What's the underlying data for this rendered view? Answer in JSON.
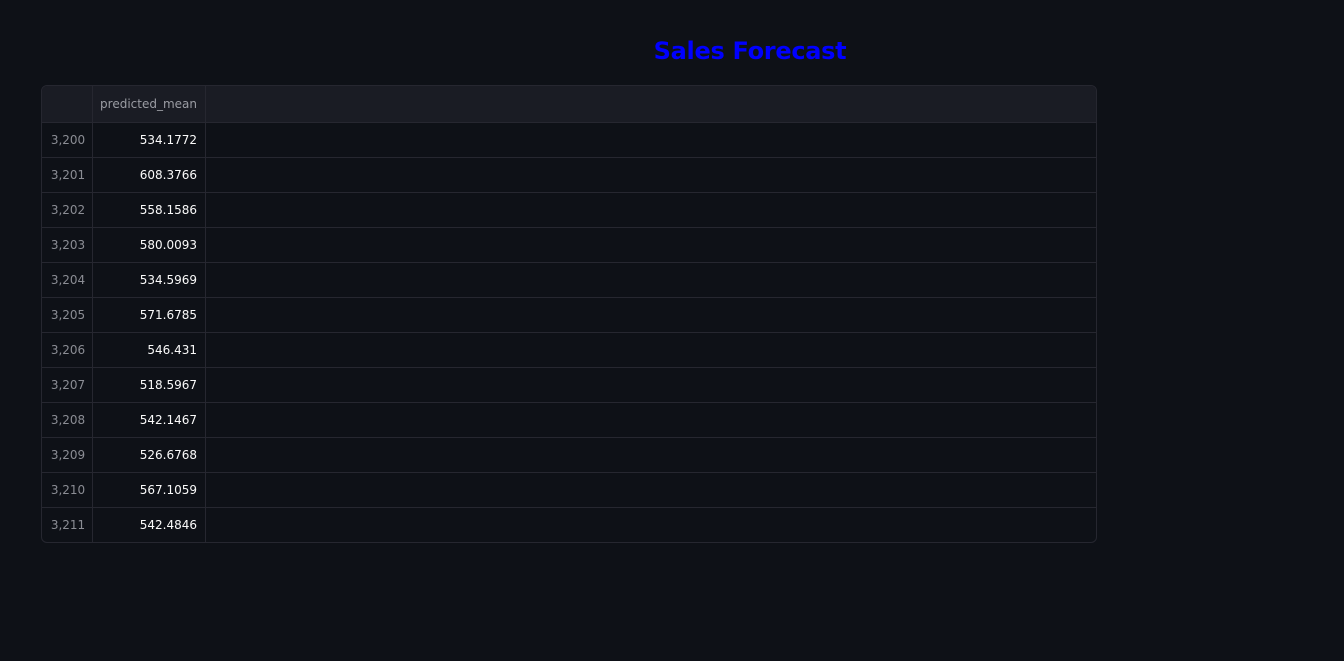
{
  "page": {
    "title": "Sales Forecast",
    "title_color": "#0000ff",
    "background": "#0e1117"
  },
  "table": {
    "index_header": "",
    "columns": [
      "predicted_mean"
    ],
    "rows": [
      {
        "index": "3,200",
        "predicted_mean": "534.1772"
      },
      {
        "index": "3,201",
        "predicted_mean": "608.3766"
      },
      {
        "index": "3,202",
        "predicted_mean": "558.1586"
      },
      {
        "index": "3,203",
        "predicted_mean": "580.0093"
      },
      {
        "index": "3,204",
        "predicted_mean": "534.5969"
      },
      {
        "index": "3,205",
        "predicted_mean": "571.6785"
      },
      {
        "index": "3,206",
        "predicted_mean": "546.431"
      },
      {
        "index": "3,207",
        "predicted_mean": "518.5967"
      },
      {
        "index": "3,208",
        "predicted_mean": "542.1467"
      },
      {
        "index": "3,209",
        "predicted_mean": "526.6768"
      },
      {
        "index": "3,210",
        "predicted_mean": "567.1059"
      },
      {
        "index": "3,211",
        "predicted_mean": "542.4846"
      }
    ]
  }
}
